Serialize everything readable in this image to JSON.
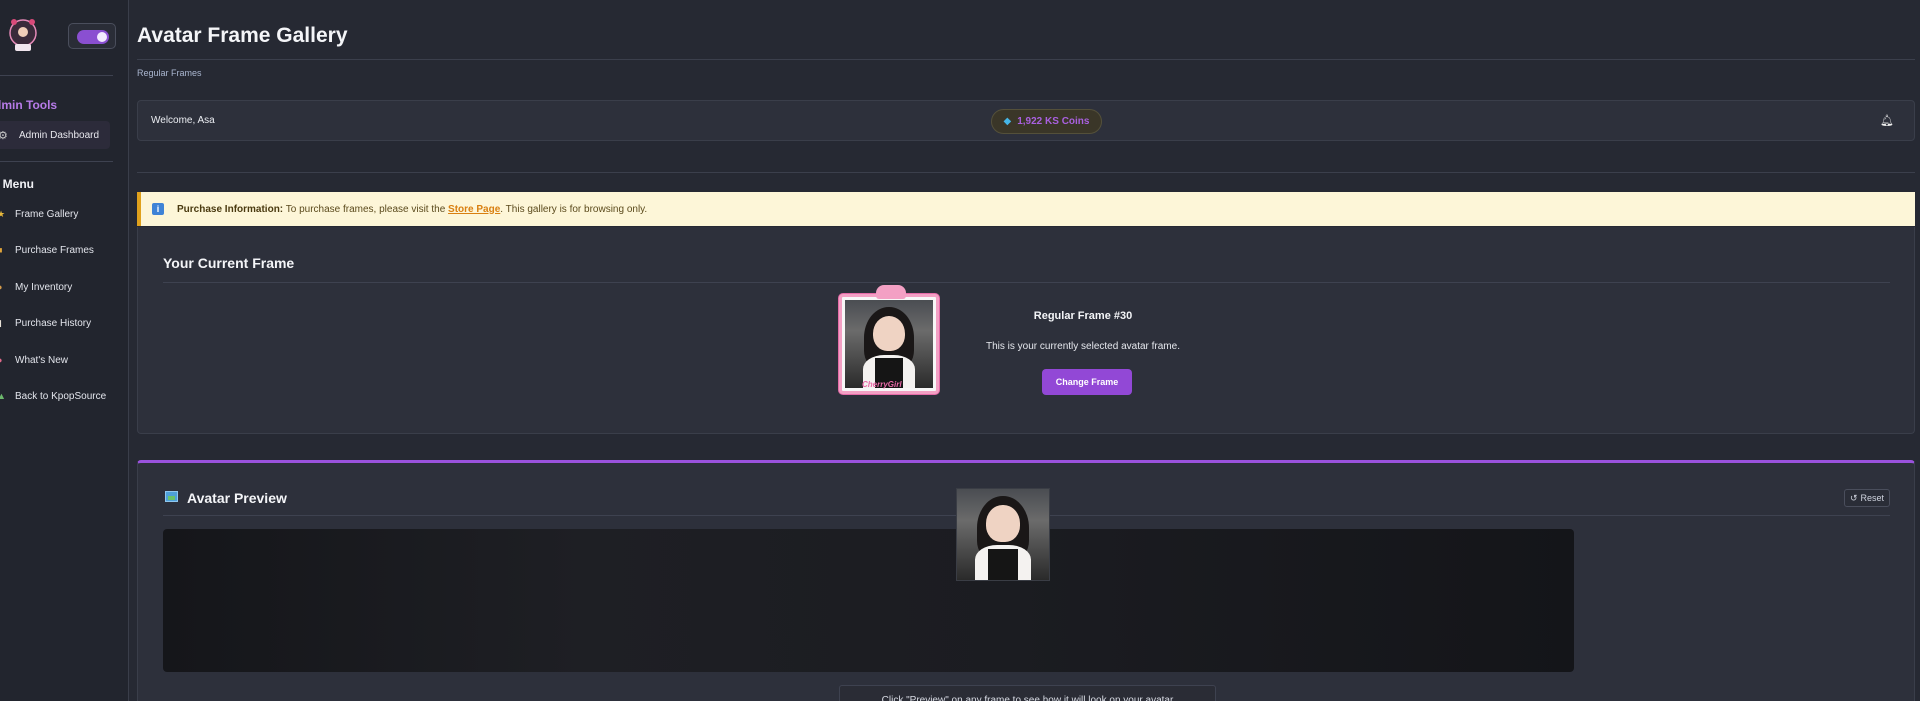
{
  "sidebar": {
    "logo_icon": "kpopsource-logo-icon",
    "theme_toggle_on": true,
    "admin_section_title": "dmin Tools",
    "admin_item": {
      "icon": "gear-icon",
      "label": "Admin Dashboard"
    },
    "user_section_title": "er Menu",
    "menu_items": [
      {
        "icon": "star-icon",
        "label": "Frame Gallery"
      },
      {
        "icon": "cart-icon",
        "label": "Purchase Frames"
      },
      {
        "icon": "box-icon",
        "label": "My Inventory"
      },
      {
        "icon": "receipt-icon",
        "label": "Purchase History"
      },
      {
        "icon": "megaphone-icon",
        "label": "What's New"
      },
      {
        "icon": "home-icon",
        "label": "Back to KpopSource"
      }
    ]
  },
  "header": {
    "title": "Avatar Frame Gallery",
    "breadcrumb": "Regular Frames"
  },
  "welcome_bar": {
    "greeting": "Welcome, Asa",
    "coins_icon": "gem-icon",
    "coins": "1,922 KS Coins",
    "bell_icon": "bell-icon"
  },
  "info_banner": {
    "icon": "info-icon",
    "bold": "Purchase Information:",
    "text_before": " To purchase frames, please visit the ",
    "link": "Store Page",
    "text_after": ". This gallery is for browsing only."
  },
  "current_frame": {
    "title": "Your Current Frame",
    "frame_name": "Regular Frame #30",
    "frame_caption": "CherryGirl",
    "description": "This is your currently selected avatar frame.",
    "change_button": "Change Frame"
  },
  "avatar_preview": {
    "icon": "image-icon",
    "title": "Avatar Preview",
    "reset_icon": "refresh-icon",
    "reset_label": "Reset",
    "hint": "Click \"Preview\" on any frame to see how it will look on your avatar"
  },
  "colors": {
    "accent": "#9248d6",
    "admin_title": "#b77be9",
    "banner_bg": "#fdf6d8",
    "banner_border": "#e0a11c",
    "coins_text": "#a960e0",
    "frame_pink": "#f3a0c4"
  }
}
